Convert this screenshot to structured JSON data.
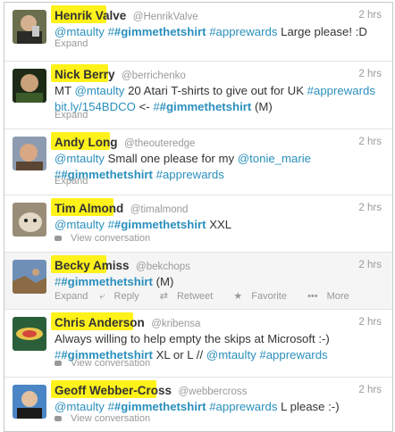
{
  "colors": {
    "link": "#2a8fbd",
    "highlight": "#fff21a",
    "meta": "#999999"
  },
  "tweets": [
    {
      "name": "Henrik Valve",
      "handle": "@HenrikValve",
      "time": "2 hrs",
      "seg1": "@mtaulty",
      "seg2": "#gimmethetshirt",
      "seg3": "#apprewards",
      "seg4": "Large please! :D",
      "footer": "Expand"
    },
    {
      "name": "Nick Berry",
      "handle": "@berrichenko",
      "time": "2 hrs",
      "seg0": "MT",
      "seg1": "@mtaulty",
      "seg2": "20 Atari T-shirts to give out for UK",
      "seg3": "#apprewards",
      "seg4": "bit.ly/154BDCO",
      "seg5": "<-",
      "seg6": "#gimmethetshirt",
      "seg7": "(M)",
      "footer": "Expand"
    },
    {
      "name": "Andy Long",
      "handle": "@theouteredge",
      "time": "2 hrs",
      "seg1": "@mtaulty",
      "seg2": "Small one please for my",
      "seg3": "@tonie_marie",
      "seg4": "#gimmethetshirt",
      "seg5": "#apprewards",
      "footer": "Expand"
    },
    {
      "name": "Tim Almond",
      "handle": "@timalmond",
      "time": "2 hrs",
      "seg1": "@mtaulty",
      "seg2": "#gimmethetshirt",
      "seg3": "XXL",
      "footer": "View conversation"
    },
    {
      "name": "Becky Amiss",
      "handle": "@bekchops",
      "time": "2 hrs",
      "seg1": "#gimmethetshirt",
      "seg2": "(M)",
      "actions": {
        "expand": "Expand",
        "reply": "Reply",
        "retweet": "Retweet",
        "favorite": "Favorite",
        "more": "More"
      }
    },
    {
      "name": "Chris Anderson",
      "handle": "@kribensa",
      "time": "2 hrs",
      "seg1": "Always willing to help empty the skips at Microsoft :-)",
      "seg2": "#gimmethetshirt",
      "seg3": "XL or L //",
      "seg4": "@mtaulty",
      "seg5": "#apprewards",
      "footer": "View conversation"
    },
    {
      "name": "Geoff Webber-Cross",
      "handle": "@webbercross",
      "time": "2 hrs",
      "seg1": "@mtaulty",
      "seg2": "#gimmethetshirt",
      "seg3": "#apprewards",
      "seg4": "L please :-)",
      "footer": "View conversation"
    }
  ]
}
